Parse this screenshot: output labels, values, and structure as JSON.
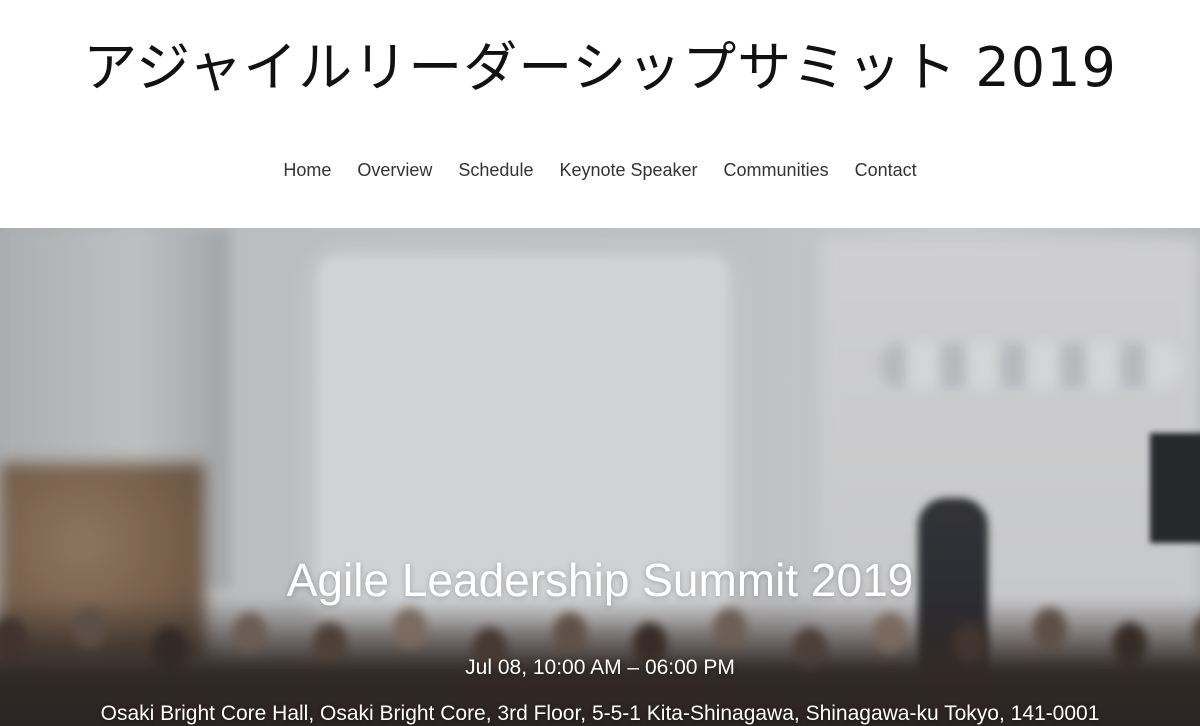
{
  "site": {
    "title": "アジャイルリーダーシップサミット 2019"
  },
  "nav": {
    "items": [
      {
        "label": "Home"
      },
      {
        "label": "Overview"
      },
      {
        "label": "Schedule"
      },
      {
        "label": "Keynote Speaker"
      },
      {
        "label": "Communities"
      },
      {
        "label": "Contact"
      }
    ]
  },
  "hero": {
    "title": "Agile Leadership Summit 2019",
    "date": "Jul 08, 10:00 AM – 06:00 PM",
    "address": "Osaki Bright Core Hall, Osaki Bright Core, 3rd Floor, 5-5-1 Kita-Shinagawa, Shinagawa-ku Tokyo, 141-0001"
  },
  "colors": {
    "header_bg": "#ffffff",
    "title_text": "#111111",
    "nav_text": "#333333",
    "hero_text": "#ffffff"
  }
}
